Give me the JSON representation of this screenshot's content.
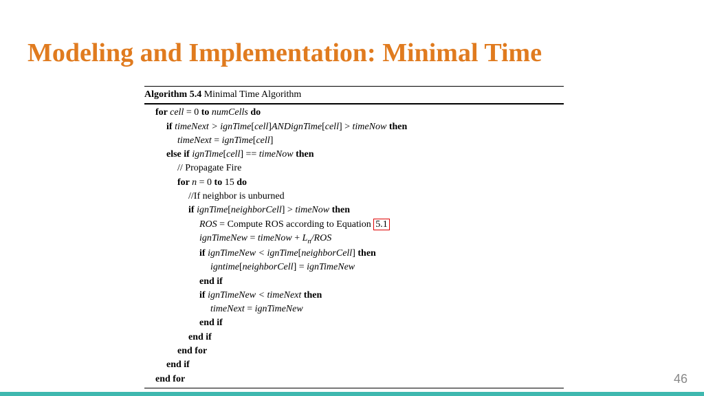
{
  "title": "Modeling and Implementation: Minimal Time",
  "page_number": "46",
  "algorithm": {
    "caption_prefix": "Algorithm 5.4",
    "caption_text": " Minimal Time Algorithm",
    "eq_ref": "5.1",
    "lines": {
      "l1_for": "for ",
      "l1_cell": "cell",
      "l1_eq": " = 0 ",
      "l1_to": "to ",
      "l1_numcells": "numCells ",
      "l1_do": "do",
      "l2_if": "if ",
      "l2_expr": "timeNext > ignTime",
      "l2_br1a": "[",
      "l2_cell1": "cell",
      "l2_br1b": "]",
      "l2_and": "AND",
      "l2_ign2": "ignTime",
      "l2_br2a": "[",
      "l2_cell2": "cell",
      "l2_br2b": "] > ",
      "l2_tnow": "timeNow ",
      "l2_then": "then",
      "l3_lhs": "timeNext",
      "l3_eq": " = ",
      "l3_rhs": "ignTime",
      "l3_bra": "[",
      "l3_cell": "cell",
      "l3_brb": "]",
      "l4_elseif": "else if ",
      "l4_ign": "ignTime",
      "l4_bra": "[",
      "l4_cell": "cell",
      "l4_brb": "] == ",
      "l4_tnow": "timeNow ",
      "l4_then": "then",
      "l5_cmt": "// Propagate Fire",
      "l6_for": "for ",
      "l6_n": "n",
      "l6_rng": " = 0 ",
      "l6_to": "to",
      "l6_15": " 15 ",
      "l6_do": "do",
      "l7_cmt": "//If neighbor is unburned",
      "l8_if": "if ",
      "l8_ign": "ignTime",
      "l8_bra": "[",
      "l8_nc": "neighborCell",
      "l8_brb": "] > ",
      "l8_tnow": "timeNow ",
      "l8_then": "then",
      "l9_ros": "ROS",
      "l9_eq": " = ",
      "l9_txt": "Compute ROS according to Equation ",
      "l10_lhs": "ignTimeNew",
      "l10_eq": " = ",
      "l10_tnow": "timeNow",
      "l10_plus": " + ",
      "l10_L": "L",
      "l10_sub": "n",
      "l10_slash": "/",
      "l10_ros": "ROS",
      "l11_if": "if ",
      "l11_lhs": "ignTimeNew < ignTime",
      "l11_bra": "[",
      "l11_nc": "neighborCell",
      "l11_brb": "] ",
      "l11_then": "then",
      "l12_lhs": "igntime",
      "l12_bra": "[",
      "l12_nc": "neighborCell",
      "l12_brb": "] = ",
      "l12_rhs": "ignTimeNew",
      "l13_endif": "end if",
      "l14_if": "if ",
      "l14_expr": "ignTimeNew < timeNext ",
      "l14_then": "then",
      "l15_lhs": "timeNext",
      "l15_eq": " = ",
      "l15_rhs": "ignTimeNew",
      "l16_endif": "end if",
      "l17_endif": "end if",
      "l18_endfor": "end for",
      "l19_endif": "end if",
      "l20_endfor": "end for"
    }
  }
}
